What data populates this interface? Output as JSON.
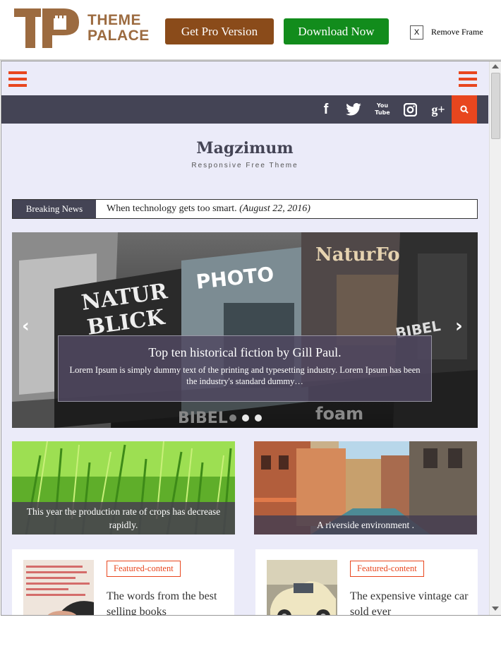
{
  "topbar": {
    "logo_text_line1": "THEME",
    "logo_text_line2": "PALACE",
    "pro_button": "Get Pro Version",
    "download_button": "Download Now",
    "remove_x": "X",
    "remove_label": "Remove Frame"
  },
  "social": [
    "facebook-icon",
    "twitter-icon",
    "youtube-icon",
    "instagram-icon",
    "google-plus-icon"
  ],
  "social_glyphs": [
    "f",
    "t",
    "You Tube",
    "◙",
    "g+"
  ],
  "site": {
    "title": "Magzimum",
    "description": "Responsive Free Theme"
  },
  "breaking": {
    "label": "Breaking News",
    "headline": "When technology gets too smart.",
    "date": "(August 22, 2016)"
  },
  "slider": {
    "title": "Top ten historical fiction by Gill Paul.",
    "text": "Lorem Ipsum is simply dummy text of the printing and typesetting industry. Lorem Ipsum has been the industry's standard dummy…",
    "prev": "‹",
    "next": "›",
    "dots": 3,
    "active_dot": 0
  },
  "cards": [
    {
      "caption": "This year the production rate of crops has decrease rapidly."
    },
    {
      "caption": "A riverside environment ."
    }
  ],
  "posts": [
    {
      "tag": "Featured-content",
      "title": "The words from the best selling books"
    },
    {
      "tag": "Featured-content",
      "title": "The expensive vintage car sold ever"
    }
  ],
  "colors": {
    "accent": "#e8461e",
    "dark": "#444455",
    "brown": "#8a4b1a",
    "green": "#128c1c",
    "page_bg": "#ebebf9"
  }
}
